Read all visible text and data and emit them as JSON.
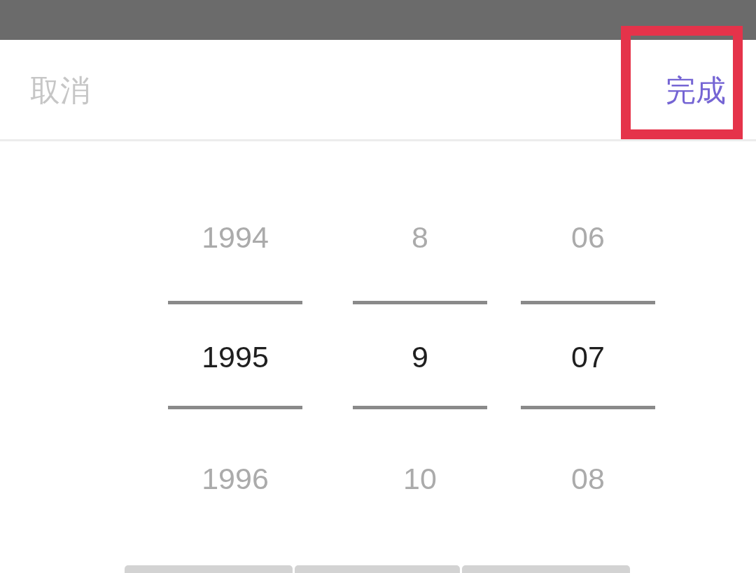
{
  "header": {
    "cancel": {
      "label": "取消"
    },
    "done": {
      "label": "完成",
      "highlighted": true
    }
  },
  "picker": {
    "columns": [
      {
        "items": [
          {
            "label": "1994",
            "selected": false
          },
          {
            "label": "1995",
            "selected": true
          },
          {
            "label": "1996",
            "selected": false
          }
        ]
      },
      {
        "items": [
          {
            "label": "8",
            "selected": false
          },
          {
            "label": "9",
            "selected": true
          },
          {
            "label": "10",
            "selected": false
          }
        ]
      },
      {
        "items": [
          {
            "label": "06",
            "selected": false
          },
          {
            "label": "07",
            "selected": true
          },
          {
            "label": "08",
            "selected": false
          }
        ]
      }
    ]
  }
}
